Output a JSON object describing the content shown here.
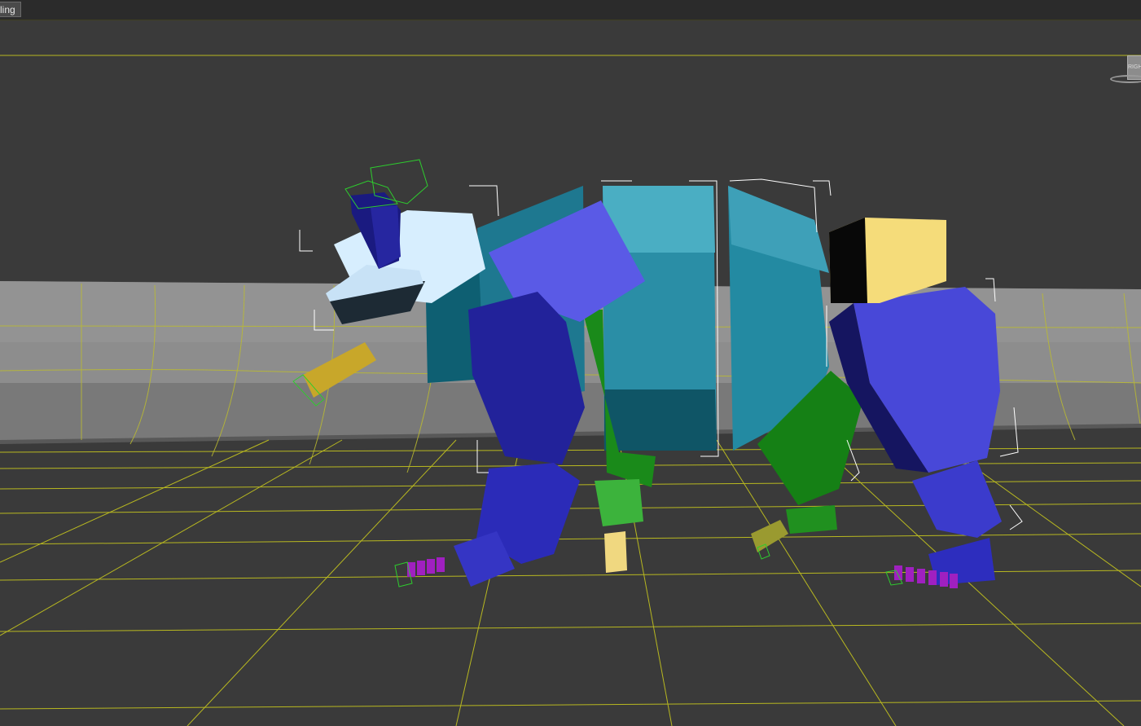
{
  "window": {
    "tab_label": "ling"
  },
  "viewport": {
    "viewcube_label": "RIGHT",
    "colors": {
      "background": "#3a3a3a",
      "grid_line": "#b8b820",
      "bone_box": "#ffffff",
      "selection_green": "#2ecc2e",
      "teal": "#2b8aa0",
      "blue": "#3030c8",
      "green": "#1a8a1a",
      "yellow": "#f5dc7a",
      "purple": "#a020c0"
    }
  }
}
